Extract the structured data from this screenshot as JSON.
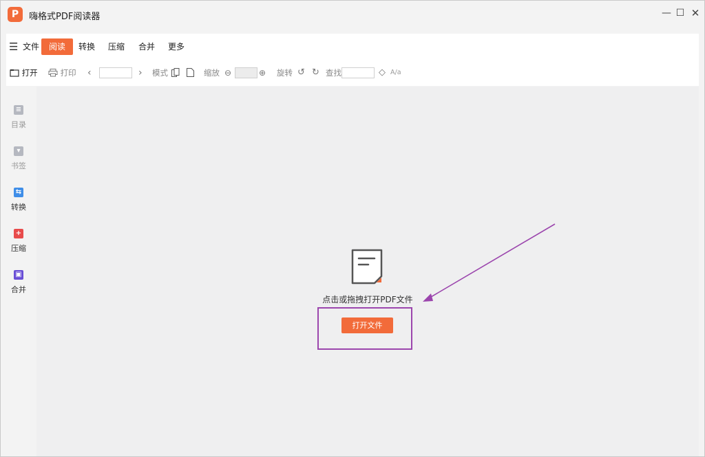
{
  "app": {
    "title": "嗨格式PDF阅读器",
    "logo_letter": "P",
    "brand_color": "#f26b3a"
  },
  "window_controls": {
    "minimize": "—",
    "maximize": "☐",
    "close": "✕"
  },
  "menu": {
    "hamburger": "☰",
    "items": [
      {
        "label": "文件",
        "active": false
      },
      {
        "label": "阅读",
        "active": true
      },
      {
        "label": "转换",
        "active": false
      },
      {
        "label": "压缩",
        "active": false
      },
      {
        "label": "合并",
        "active": false
      },
      {
        "label": "更多",
        "active": false
      }
    ]
  },
  "toolbar": {
    "open_label": "打开",
    "print_label": "打印",
    "prev_page": "‹",
    "page_input_value": "",
    "next_page": "›",
    "mode_label": "模式",
    "zoom_label": "缩放",
    "zoom_out": "⊖",
    "zoom_value": "",
    "zoom_in": "⊕",
    "rotate_label": "旋转",
    "rotate_ccw": "↺",
    "rotate_cw": "↻",
    "find_label": "查找",
    "find_value": "",
    "find_nav": "◇",
    "case_toggle": "A/a"
  },
  "sidebar": {
    "items": [
      {
        "label": "目录",
        "icon": "toc-icon",
        "color": "#b5b8c0"
      },
      {
        "label": "书签",
        "icon": "bookmark-icon",
        "color": "#b5b8c0"
      },
      {
        "label": "转换",
        "icon": "convert-icon",
        "color": "#3f8ee8"
      },
      {
        "label": "压缩",
        "icon": "compress-icon",
        "color": "#e84b4b"
      },
      {
        "label": "合并",
        "icon": "merge-icon",
        "color": "#6a4fd6"
      }
    ]
  },
  "main": {
    "hint": "点击或拖拽打开PDF文件",
    "open_button": "打开文件",
    "annotation_color": "#9b45ad"
  }
}
